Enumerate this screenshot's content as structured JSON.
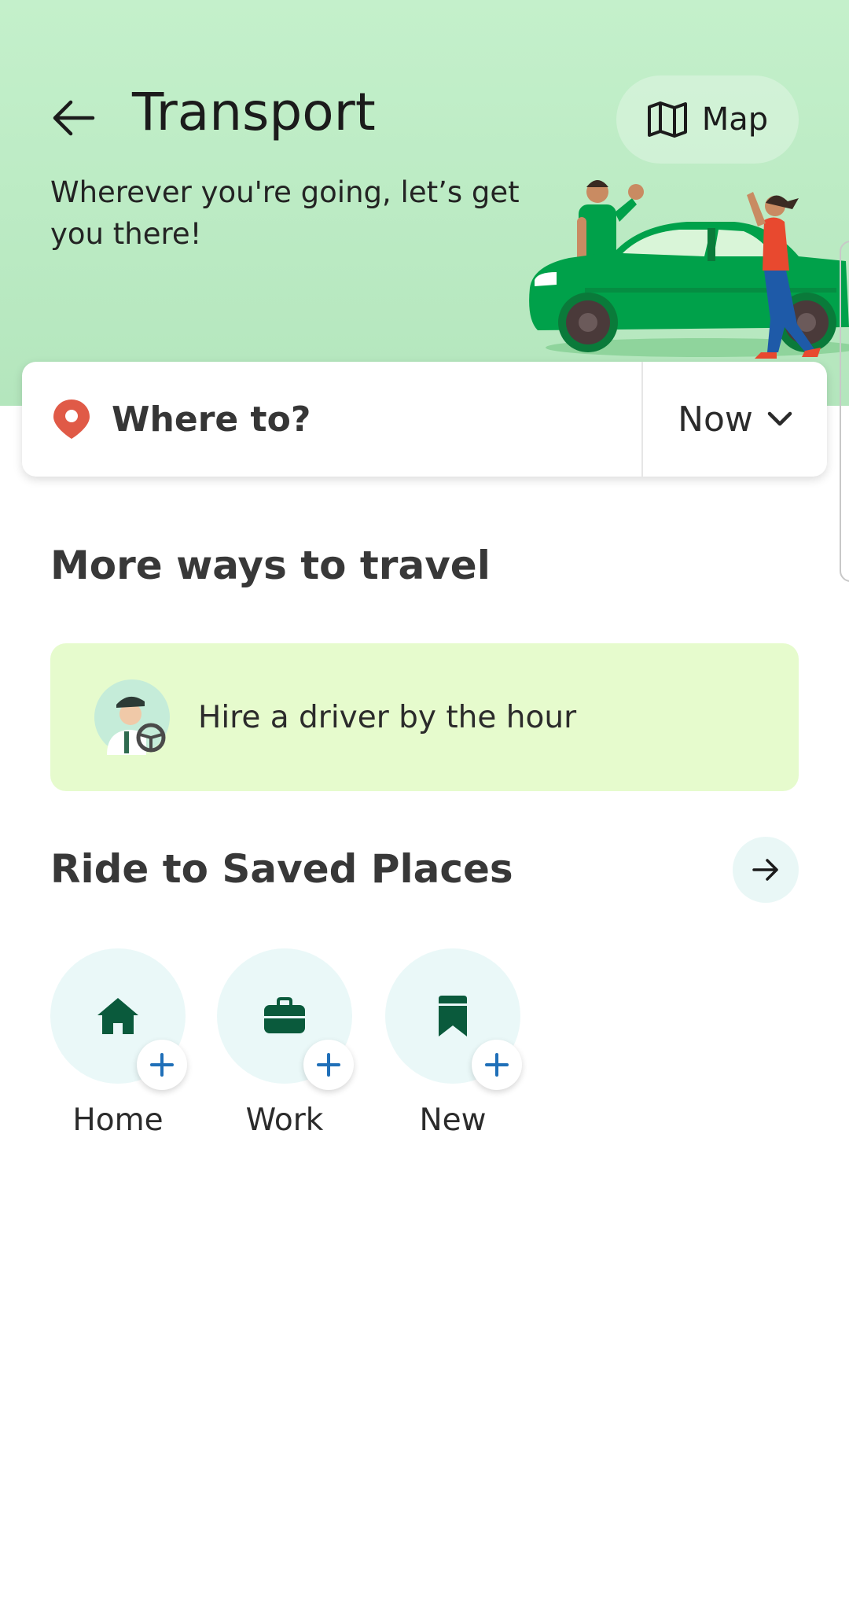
{
  "header": {
    "title": "Transport",
    "subtitle": "Wherever you're going, let’s get you there!",
    "map_label": "Map",
    "back_icon": "arrow-left-icon",
    "map_icon": "map-icon"
  },
  "search": {
    "destination_placeholder": "Where to?",
    "time_value": "Now",
    "pin_icon": "location-pin-icon",
    "dropdown_icon": "chevron-down-icon"
  },
  "more_ways": {
    "title": "More ways to travel",
    "hire_driver_label": "Hire a driver by the hour"
  },
  "saved_places": {
    "title": "Ride to Saved Places",
    "arrow_icon": "arrow-right-icon",
    "items": [
      {
        "label": "Home",
        "icon": "home-icon"
      },
      {
        "label": "Work",
        "icon": "briefcase-icon"
      },
      {
        "label": "New",
        "icon": "bookmark-icon"
      }
    ]
  },
  "colors": {
    "header_bg": "#c4f0cb",
    "brand_dark_green": "#0a5a3c",
    "car_green": "#00a14a",
    "pin_red": "#e05a47",
    "plus_blue": "#1f6fb8",
    "hire_card_bg": "#e6fbcd"
  }
}
